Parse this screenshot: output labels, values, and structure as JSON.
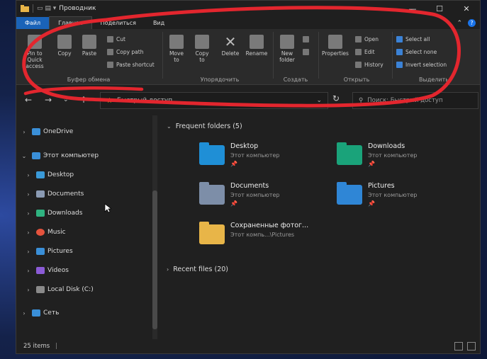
{
  "window": {
    "title": "Проводник"
  },
  "tabs": [
    "Файл",
    "Главная",
    "Поделиться",
    "Вид"
  ],
  "ribbon": {
    "clipboard": {
      "pin": "Pin to Quick access",
      "copy": "Copy",
      "paste": "Paste",
      "cut": "Cut",
      "copy_path": "Copy path",
      "paste_shortcut": "Paste shortcut",
      "label": "Буфер обмена"
    },
    "organize": {
      "move_to": "Move to",
      "copy_to": "Copy to",
      "delete": "Delete",
      "rename": "Rename",
      "label": "Упорядочить"
    },
    "new": {
      "new_folder": "New folder",
      "label": "Создать"
    },
    "open": {
      "properties": "Properties",
      "open": "Open",
      "edit": "Edit",
      "history": "History",
      "label": "Открыть"
    },
    "select": {
      "select_all": "Select all",
      "select_none": "Select none",
      "invert": "Invert selection",
      "label": "Выделить"
    }
  },
  "address": {
    "path": "Быстрый доступ",
    "search_placeholder": "Поиск: Быстрый доступ"
  },
  "sidebar": {
    "items": [
      {
        "label": "OneDrive",
        "color": "#3a8fd8"
      },
      {
        "label": "Этот компьютер",
        "color": "#3a8fd8"
      },
      {
        "label": "Desktop",
        "color": "#3a9ad9"
      },
      {
        "label": "Documents",
        "color": "#8b9bb4"
      },
      {
        "label": "Downloads",
        "color": "#2fb380"
      },
      {
        "label": "Music",
        "color": "#e5533d"
      },
      {
        "label": "Pictures",
        "color": "#3a8fd8"
      },
      {
        "label": "Videos",
        "color": "#8b5bd6"
      },
      {
        "label": "Local Disk (C:)",
        "color": "#8a8a8a"
      },
      {
        "label": "Сеть",
        "color": "#3a8fd8"
      }
    ]
  },
  "content": {
    "frequent_header": "Frequent folders (5)",
    "recent_header": "Recent files (20)",
    "folders": [
      {
        "name": "Desktop",
        "location": "Этот компьютер",
        "color": "#1f8fd6"
      },
      {
        "name": "Downloads",
        "location": "Этот компьютер",
        "color": "#1aa37a"
      },
      {
        "name": "Documents",
        "location": "Этот компьютер",
        "color": "#7d8ea8"
      },
      {
        "name": "Pictures",
        "location": "Этот компьютер",
        "color": "#2f86d6"
      },
      {
        "name": "Сохраненные фотог...",
        "location": "Этот компь...\\Pictures",
        "color": "#e8b548"
      }
    ]
  },
  "status": {
    "items": "25 items"
  },
  "annotation_color": "#e3262e"
}
